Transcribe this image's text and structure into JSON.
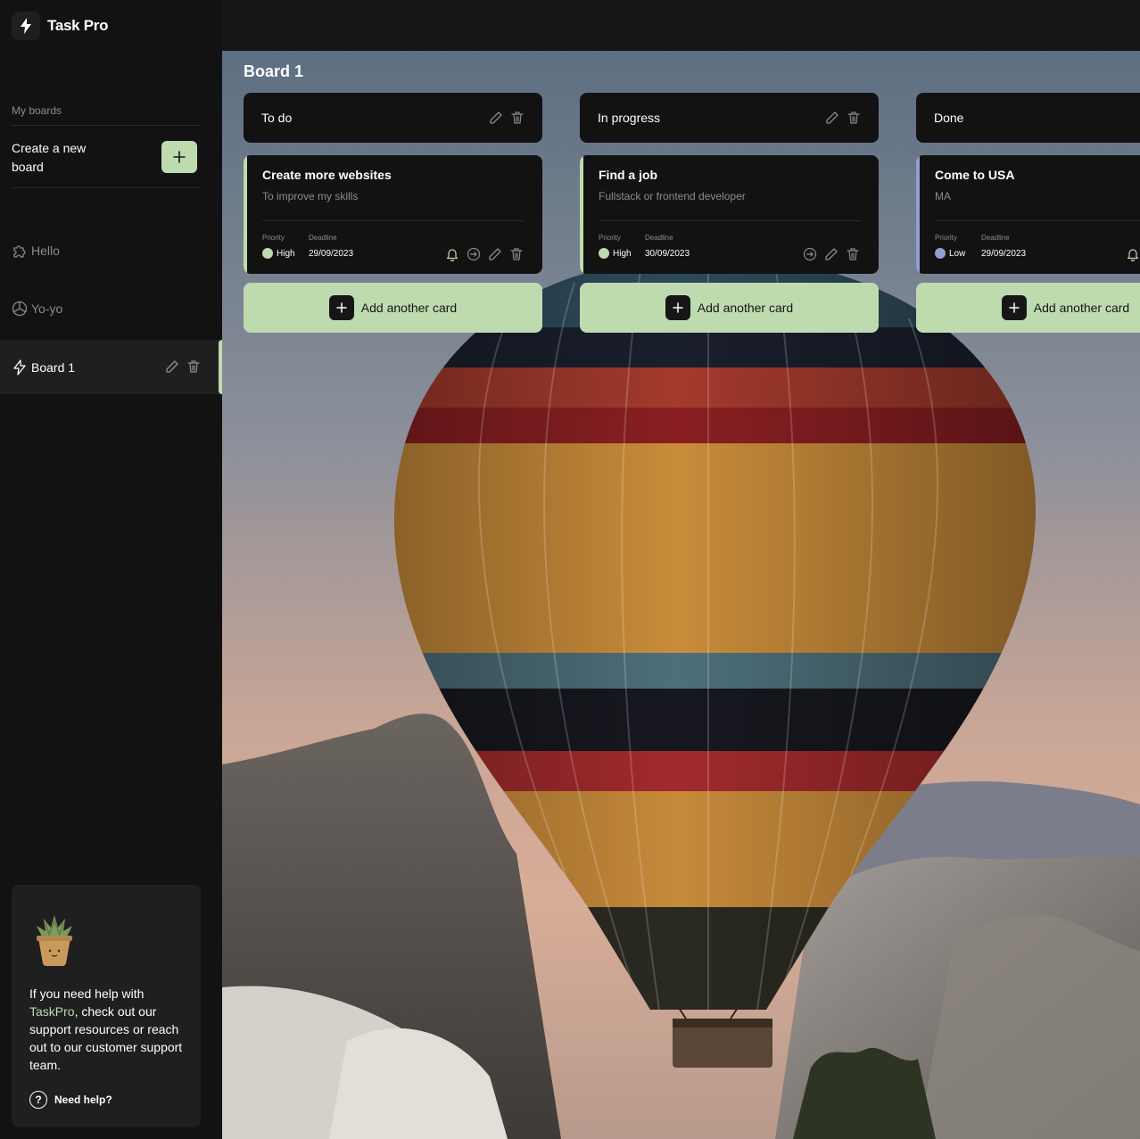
{
  "app": {
    "name": "Task Pro"
  },
  "sidebar": {
    "section_label": "My boards",
    "create_label": "Create a new board",
    "boards": [
      {
        "label": "Hello",
        "icon": "puzzle-icon"
      },
      {
        "label": "Yo-yo",
        "icon": "colors-icon"
      },
      {
        "label": "Board 1",
        "icon": "lightning-icon",
        "active": true
      }
    ],
    "help": {
      "text_before": "If you need help with ",
      "brand": "TaskPro",
      "text_after": ", check out our support resources or reach out to our customer support team.",
      "link": "Need help?"
    }
  },
  "board": {
    "title": "Board 1",
    "add_card_label": "Add another card",
    "columns": [
      {
        "title": "To do",
        "cards": [
          {
            "title": "Create more websites",
            "description": "To improve my skills",
            "priority_label": "Priority",
            "priority": "High",
            "deadline_label": "Deadline",
            "deadline": "29/09/2023",
            "priority_color": "#bedbb0"
          }
        ]
      },
      {
        "title": "In progress",
        "cards": [
          {
            "title": "Find a job",
            "description": "Fullstack or frontend developer",
            "priority_label": "Priority",
            "priority": "High",
            "deadline_label": "Deadline",
            "deadline": "30/09/2023",
            "priority_color": "#bedbb0"
          }
        ]
      },
      {
        "title": "Done",
        "cards": [
          {
            "title": "Come to USA",
            "description": "MA",
            "priority_label": "Priority",
            "priority": "Low",
            "deadline_label": "Deadline",
            "deadline": "29/09/2023",
            "priority_color": "#8fa1d0"
          }
        ]
      }
    ]
  },
  "colors": {
    "accent": "#bedbb0",
    "sidebar_bg": "#121212",
    "card_bg": "#121212",
    "low_priority": "#8fa1d0"
  }
}
